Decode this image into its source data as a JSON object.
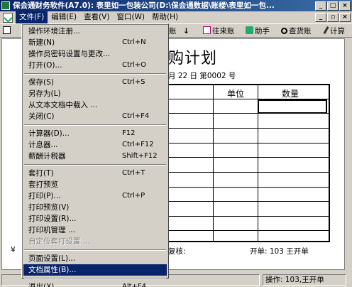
{
  "window": {
    "title": "保会通财务软件(A7.0): 表里如一包装公司(D:\\保会通数据\\账楼\\表里如一包...",
    "buttons": {
      "minimize": "_",
      "maximize": "□",
      "close": "×"
    }
  },
  "menubar": {
    "items": [
      "文件(F)",
      "编辑(E)",
      "查看(V)",
      "窗口(W)",
      "帮助(H)"
    ],
    "active_index": 0,
    "mdi_buttons": {
      "minimize": "_",
      "restore": "▫",
      "close": "×"
    }
  },
  "toolbar": {
    "partial_label": "账",
    "arrow_glyph": "↓",
    "items": [
      "往来账",
      "助手",
      "查货账",
      "计算"
    ]
  },
  "document": {
    "title": "购计划",
    "date_line": "月 22 日 第0002 号",
    "columns": [
      "单位",
      "数量"
    ],
    "reviewer_label": "复核:",
    "preparer_label": "开单: 103 王开单",
    "left_mark": "¥"
  },
  "statusbar": {
    "operator": "操作: 103,王开单"
  },
  "file_menu": {
    "groups": [
      [
        {
          "label": "操作环境注册...",
          "shortcut": ""
        },
        {
          "label": "新建(N)",
          "shortcut": "Ctrl+N"
        },
        {
          "label": "操作员密码设置与更改...",
          "shortcut": ""
        },
        {
          "label": "打开(O)...",
          "shortcut": "Ctrl+O"
        }
      ],
      [
        {
          "label": "保存(S)",
          "shortcut": "Ctrl+S"
        },
        {
          "label": "另存为(L)",
          "shortcut": ""
        },
        {
          "label": "从文本文档中载入 ...",
          "shortcut": ""
        },
        {
          "label": "关闭(C)",
          "shortcut": "Ctrl+F4"
        }
      ],
      [
        {
          "label": "计算器(D)...",
          "shortcut": "F12"
        },
        {
          "label": "计息器...",
          "shortcut": "Ctrl+F12"
        },
        {
          "label": "薪酬计税器",
          "shortcut": "Shift+F12"
        }
      ],
      [
        {
          "label": "套打(T)",
          "shortcut": "Ctrl+T"
        },
        {
          "label": "套打预览",
          "shortcut": ""
        },
        {
          "label": "打印(P)...",
          "shortcut": "Ctrl+P"
        },
        {
          "label": "打印预览(V)",
          "shortcut": ""
        },
        {
          "label": "打印设置(R)...",
          "shortcut": ""
        },
        {
          "label": "打印机管理 ...",
          "shortcut": ""
        },
        {
          "label": "自定位套打设置 ...",
          "shortcut": "",
          "disabled": true
        }
      ],
      [
        {
          "label": "页面设置(L)...",
          "shortcut": ""
        },
        {
          "label": "文档属性(B)...",
          "shortcut": "",
          "highlighted": true
        }
      ],
      [
        {
          "label": "退出(X)",
          "shortcut": "Alt+F4"
        }
      ]
    ]
  }
}
